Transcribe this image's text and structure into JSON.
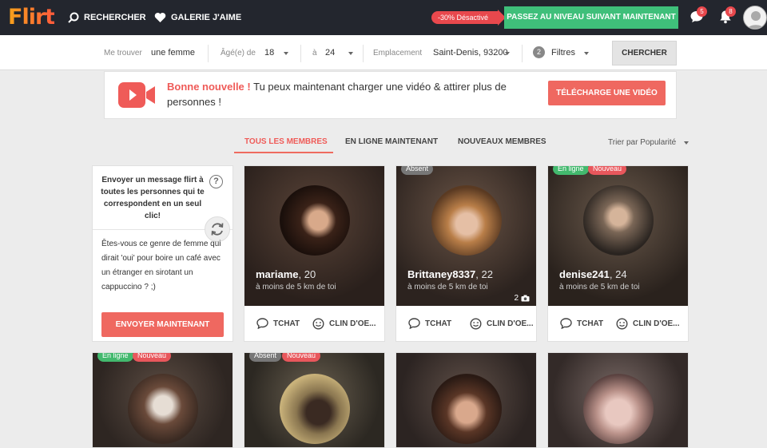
{
  "header": {
    "logo": "Flirt",
    "nav": {
      "search": "RECHERCHER",
      "gallery": "GALERIE J'AIME"
    },
    "promo_badge": "-30% Désactivé",
    "upgrade_label": "PASSEZ AU NIVEAU SUIVANT MAINTENANT",
    "messages_count": "5",
    "notifications_count": "8"
  },
  "filters": {
    "find_label": "Me trouver",
    "find_value": "une femme",
    "age_label": "Âgé(e) de",
    "age_min": "18",
    "age_sep": "à",
    "age_max": "24",
    "location_label": "Emplacement",
    "location_value": "Saint-Denis, 93200",
    "filters_count": "2",
    "filters_label": "Filtres",
    "search_label": "CHERCHER"
  },
  "banner": {
    "highlight": "Bonne nouvelle !",
    "text": " Tu peux maintenant charger une vidéo & attirer plus de personnes !",
    "button": "TÉLÉCHARGE UNE VIDÉO"
  },
  "tabs": [
    {
      "label": "TOUS LES MEMBRES"
    },
    {
      "label": "EN LIGNE MAINTENANT"
    },
    {
      "label": "NOUVEAUX MEMBRES"
    }
  ],
  "sort_label": "Trier par Popularité",
  "message_card": {
    "title": "Envoyer un message flirt à toutes les personnes qui te correspondent en un seul clic!",
    "help": "?",
    "body": "Êtes-vous ce genre de femme qui dirait 'oui' pour boire un café avec un étranger en sirotant un cappuccino ? ;)",
    "button": "ENVOYER MAINTENANT"
  },
  "actions": {
    "chat": "TCHAT",
    "wink": "CLIN D'OE..."
  },
  "profiles": [
    {
      "name": "mariame",
      "age": ", 20",
      "distance": "à moins de 5 km de toi",
      "tags": []
    },
    {
      "name": "Brittaney8337",
      "age": ", 22",
      "distance": "à moins de 5 km de toi",
      "tags": [
        "Absent"
      ],
      "photos": "2"
    },
    {
      "name": "denise241",
      "age": ", 24",
      "distance": "à moins de 5 km de toi",
      "tags": [
        "En ligne",
        "Nouveau"
      ]
    },
    {
      "tags": [
        "En ligne",
        "Nouveau"
      ]
    },
    {
      "tags": [
        "Absent",
        "Nouveau"
      ]
    },
    {
      "tags": []
    },
    {
      "tags": []
    }
  ]
}
